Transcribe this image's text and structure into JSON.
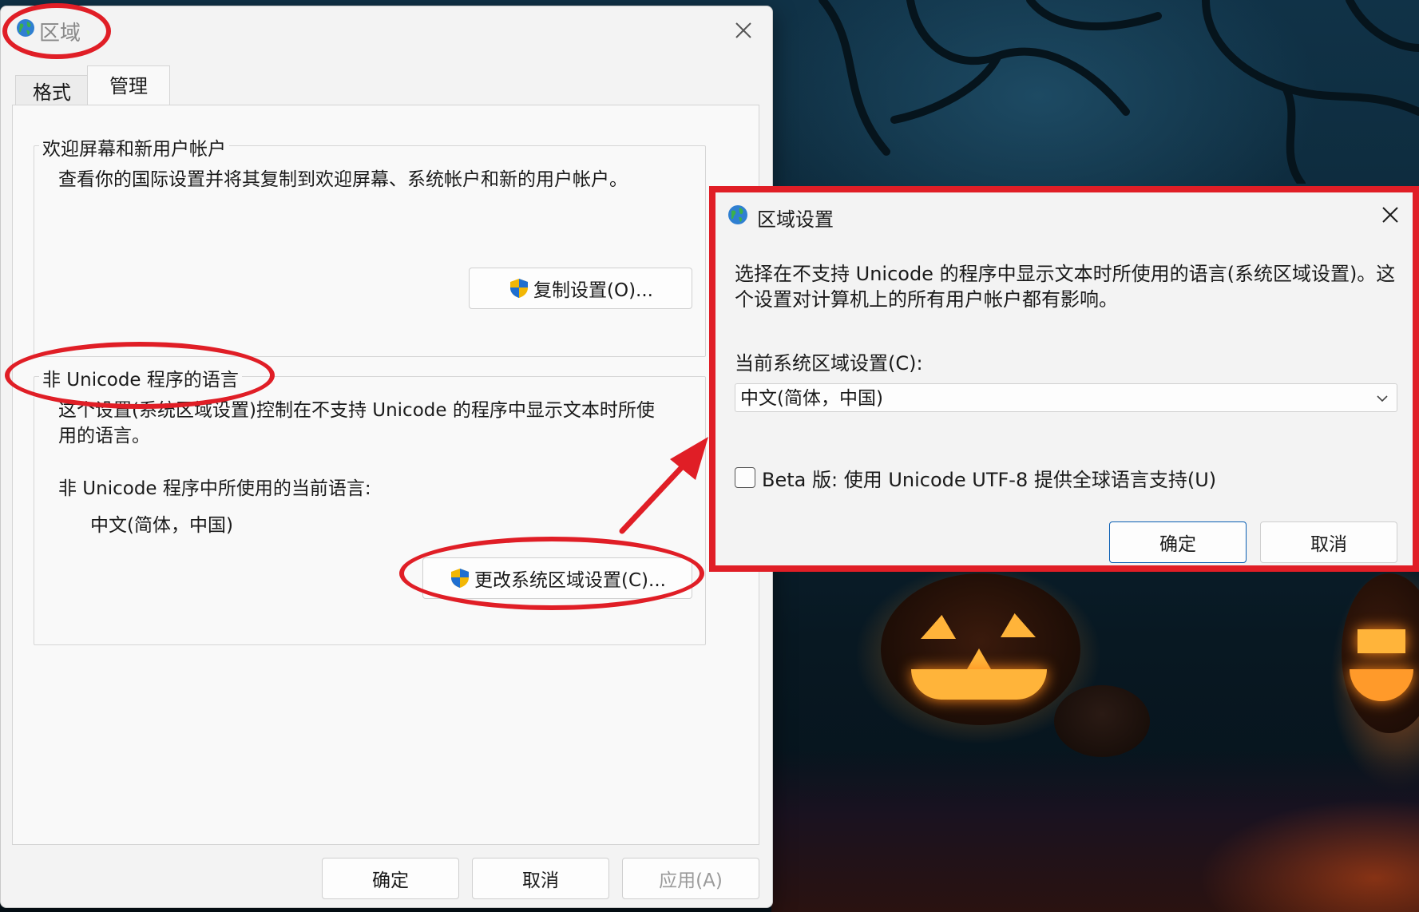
{
  "main_window": {
    "title": "区域",
    "tabs": [
      {
        "label": "格式",
        "active": false
      },
      {
        "label": "管理",
        "active": true
      }
    ],
    "welcome_group": {
      "title": "欢迎屏幕和新用户帐户",
      "description": "查看你的国际设置并将其复制到欢迎屏幕、系统帐户和新的用户帐户。",
      "button_label": "复制设置(O)...",
      "button_icon": "uac-shield-icon"
    },
    "non_unicode_group": {
      "title": "非 Unicode 程序的语言",
      "description_line1": "这个设置(系统区域设置)控制在不支持 Unicode 的程序中显示文本时所使",
      "description_line2": "用的语言。",
      "current_label": "非 Unicode 程序中所使用的当前语言:",
      "current_value": "中文(简体，中国)",
      "button_label": "更改系统区域设置(C)...",
      "button_icon": "uac-shield-icon"
    },
    "footer": {
      "ok_label": "确定",
      "cancel_label": "取消",
      "apply_label": "应用(A)",
      "apply_enabled": false
    }
  },
  "sub_window": {
    "title": "区域设置",
    "description_line1": "选择在不支持 Unicode 的程序中显示文本时所使用的语言(系统区域设置)。这",
    "description_line2": "个设置对计算机上的所有用户帐户都有影响。",
    "current_label": "当前系统区域设置(C):",
    "current_value": "中文(简体，中国)",
    "checkbox_label": "Beta 版: 使用 Unicode UTF-8 提供全球语言支持(U)",
    "checkbox_checked": false,
    "ok_label": "确定",
    "cancel_label": "取消"
  },
  "colors": {
    "annotation_red": "#e01e26",
    "primary_border": "#0a5fb4",
    "dialog_bg": "#f3f3f3"
  }
}
